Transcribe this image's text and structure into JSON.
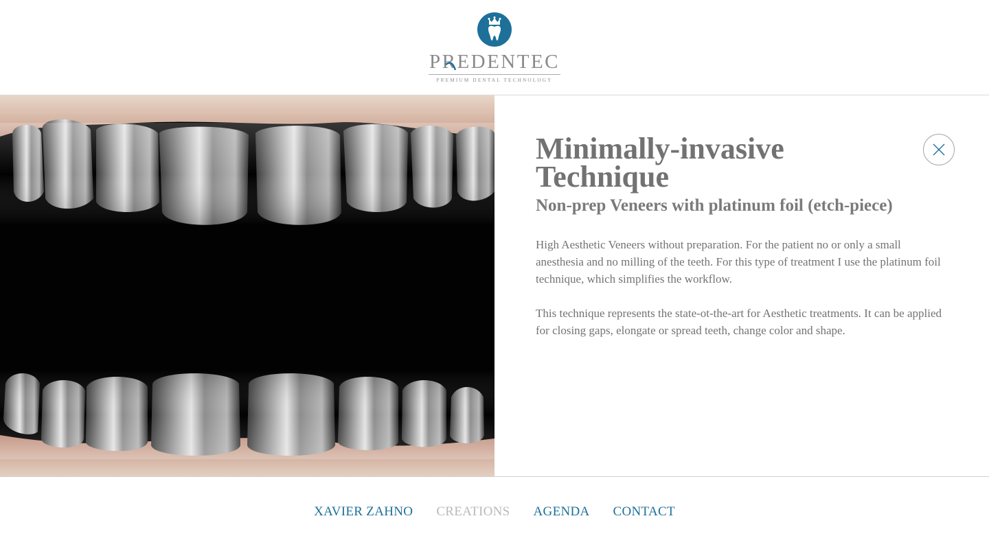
{
  "brand": {
    "name": "PREDENTEC",
    "tagline": "PREMIUM DENTAL TECHNOLOGY",
    "badge_color": "#1d7099",
    "badge_icon": "tooth-crown-icon"
  },
  "photo": {
    "icon": "platinum-foil-veneers-photo"
  },
  "detail": {
    "title": "Minimally-invasive Technique",
    "subtitle": "Non-prep Veneers with platinum foil (etch-piece)",
    "paragraph_1": "High Aesthetic Veneers without preparation. For the patient no or only a small anesthesia and no milling of the teeth. For this type of treatment I use the platinum foil technique, which simplifies the workflow.",
    "paragraph_2": "This technique represents the state-ot-the-art for Aesthetic treatments. It can be applied for closing gaps, elongate or spread teeth, change color and shape.",
    "close_icon": "close-icon"
  },
  "nav": {
    "items": [
      {
        "label": "XAVIER ZAHNO",
        "active": false
      },
      {
        "label": "CREATIONS",
        "active": true
      },
      {
        "label": "AGENDA",
        "active": false
      },
      {
        "label": "CONTACT",
        "active": false
      }
    ],
    "link_color": "#1d6f99",
    "active_color": "#b9b9b9"
  }
}
